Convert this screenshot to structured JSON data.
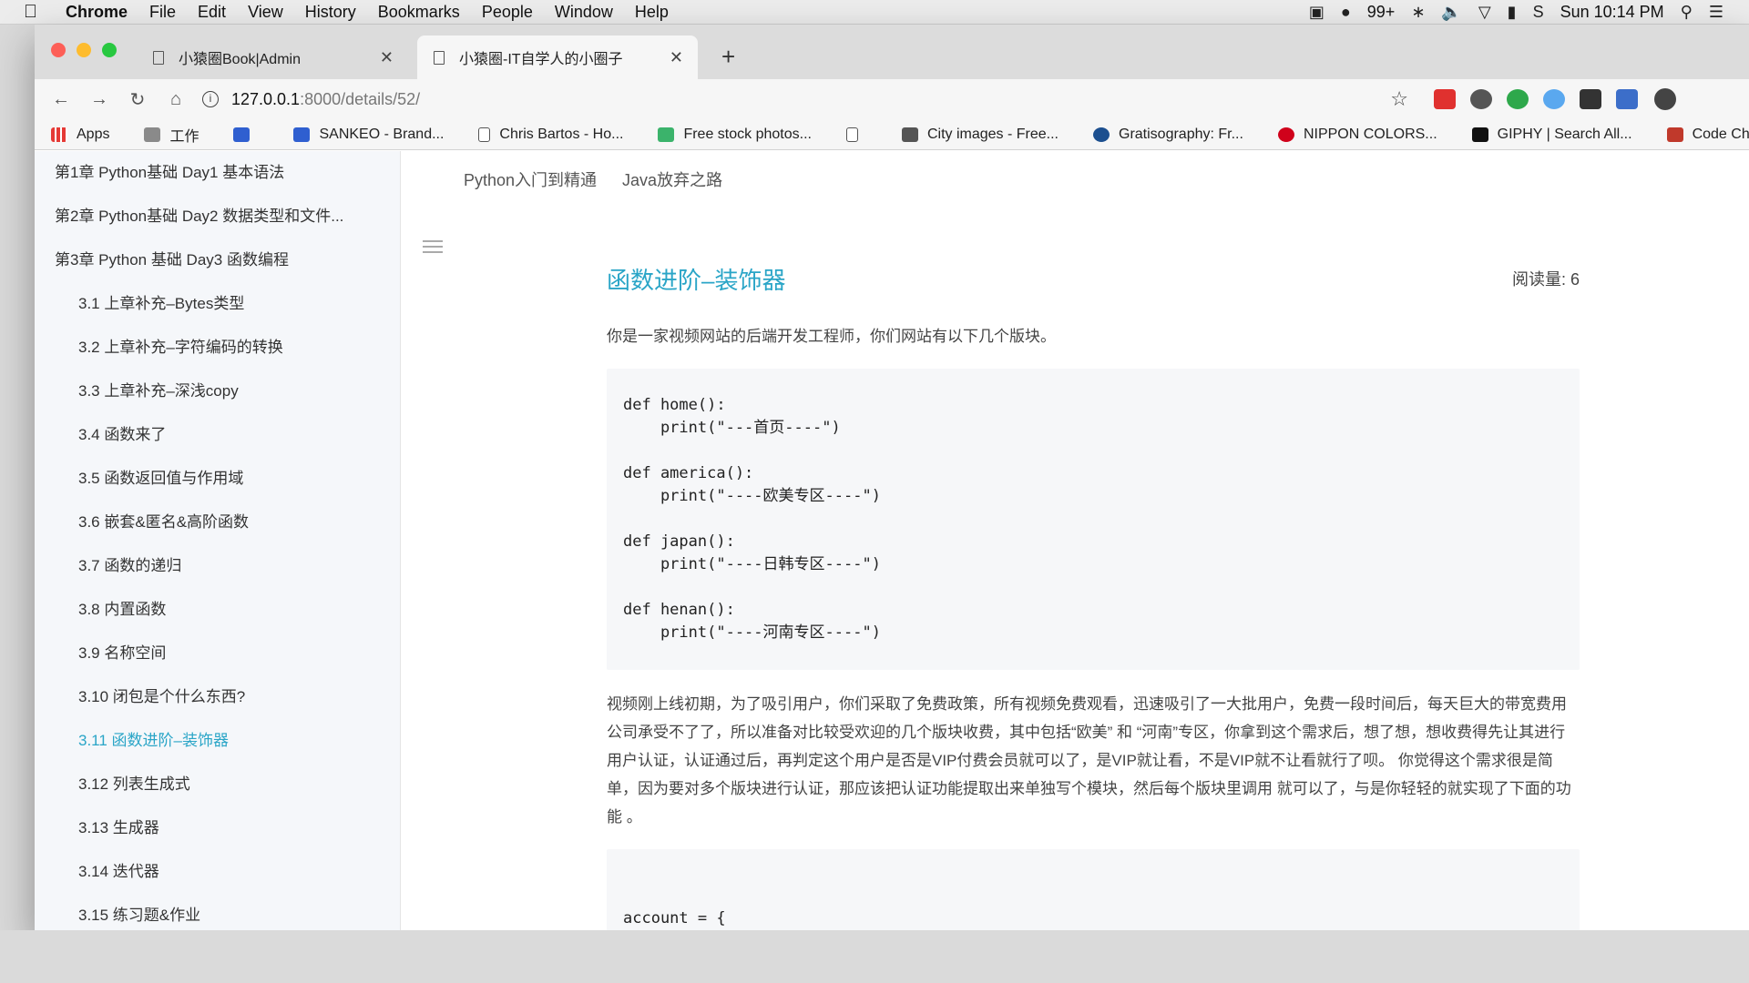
{
  "menubar": {
    "app": "Chrome",
    "items": [
      "File",
      "Edit",
      "View",
      "History",
      "Bookmarks",
      "People",
      "Window",
      "Help"
    ],
    "notifications": "99+",
    "clock": "Sun 10:14 PM"
  },
  "tabs": [
    {
      "label": "小猿圈Book|Admin"
    },
    {
      "label": "小猿圈-IT自学人的小圈子"
    }
  ],
  "address": {
    "host": "127.0.0.1",
    "path": ":8000/details/52/"
  },
  "bookmarks": [
    {
      "label": "Apps",
      "icon": "apps-icon"
    },
    {
      "label": "工作",
      "icon": "folder-icon"
    },
    {
      "label": "",
      "icon": "bookmark-icon"
    },
    {
      "label": "SANKEO - Brand...",
      "icon": "behance-icon"
    },
    {
      "label": "Chris Bartos - Ho...",
      "icon": "doc-icon"
    },
    {
      "label": "Free stock photos...",
      "icon": "photo-icon"
    },
    {
      "label": "",
      "icon": "doc-icon"
    },
    {
      "label": "City images - Free...",
      "icon": "camera-icon"
    },
    {
      "label": "Gratisography: Fr...",
      "icon": "gratisography-icon"
    },
    {
      "label": "NIPPON COLORS...",
      "icon": "nippon-icon"
    },
    {
      "label": "GIPHY | Search All...",
      "icon": "giphy-icon"
    },
    {
      "label": "Code Charts",
      "icon": "codecharts-icon"
    }
  ],
  "sidebar": {
    "items": [
      {
        "label": "第1章 Python基础 Day1 基本语法",
        "level": "chapter"
      },
      {
        "label": "第2章 Python基础 Day2 数据类型和文件...",
        "level": "chapter"
      },
      {
        "label": "第3章 Python 基础 Day3 函数编程",
        "level": "chapter"
      },
      {
        "label": "3.1 上章补充–Bytes类型",
        "level": "section"
      },
      {
        "label": "3.2 上章补充–字符编码的转换",
        "level": "section"
      },
      {
        "label": "3.3 上章补充–深浅copy",
        "level": "section"
      },
      {
        "label": "3.4 函数来了",
        "level": "section"
      },
      {
        "label": "3.5 函数返回值与作用域",
        "level": "section"
      },
      {
        "label": "3.6 嵌套&匿名&高阶函数",
        "level": "section"
      },
      {
        "label": "3.7 函数的递归",
        "level": "section"
      },
      {
        "label": "3.8 内置函数",
        "level": "section"
      },
      {
        "label": "3.9 名称空间",
        "level": "section"
      },
      {
        "label": "3.10 闭包是个什么东西?",
        "level": "section"
      },
      {
        "label": "3.11 函数进阶–装饰器",
        "level": "section",
        "active": true
      },
      {
        "label": "3.12 列表生成式",
        "level": "section"
      },
      {
        "label": "3.13 生成器",
        "level": "section"
      },
      {
        "label": "3.14 迭代器",
        "level": "section"
      },
      {
        "label": "3.15 练习题&作业",
        "level": "section"
      }
    ]
  },
  "topnav": [
    "Python入门到精通",
    "Java放弃之路"
  ],
  "article": {
    "title": "函数进阶–装饰器",
    "reads": "阅读量: 6",
    "intro": "你是一家视频网站的后端开发工程师，你们网站有以下几个版块。",
    "code1": "def home():\n    print(\"---首页----\")\n\ndef america():\n    print(\"----欧美专区----\")\n\ndef japan():\n    print(\"----日韩专区----\")\n\ndef henan():\n    print(\"----河南专区----\")",
    "body": "视频刚上线初期，为了吸引用户，你们采取了免费政策，所有视频免费观看，迅速吸引了一大批用户，免费一段时间后，每天巨大的带宽费用公司承受不了了，所以准备对比较受欢迎的几个版块收费，其中包括“欧美” 和 “河南”专区，你拿到这个需求后，想了想，想收费得先让其进行用户认证，认证通过后，再判定这个用户是否是VIP付费会员就可以了，是VIP就让看，不是VIP就不让看就行了呗。 你觉得这个需求很是简单，因为要对多个版块进行认证，那应该把认证功能提取出来单独写个模块，然后每个版块里调用 就可以了，与是你轻轻的就实现了下面的功能 。",
    "code2": "account = {"
  },
  "accent": "#2aa5c7"
}
